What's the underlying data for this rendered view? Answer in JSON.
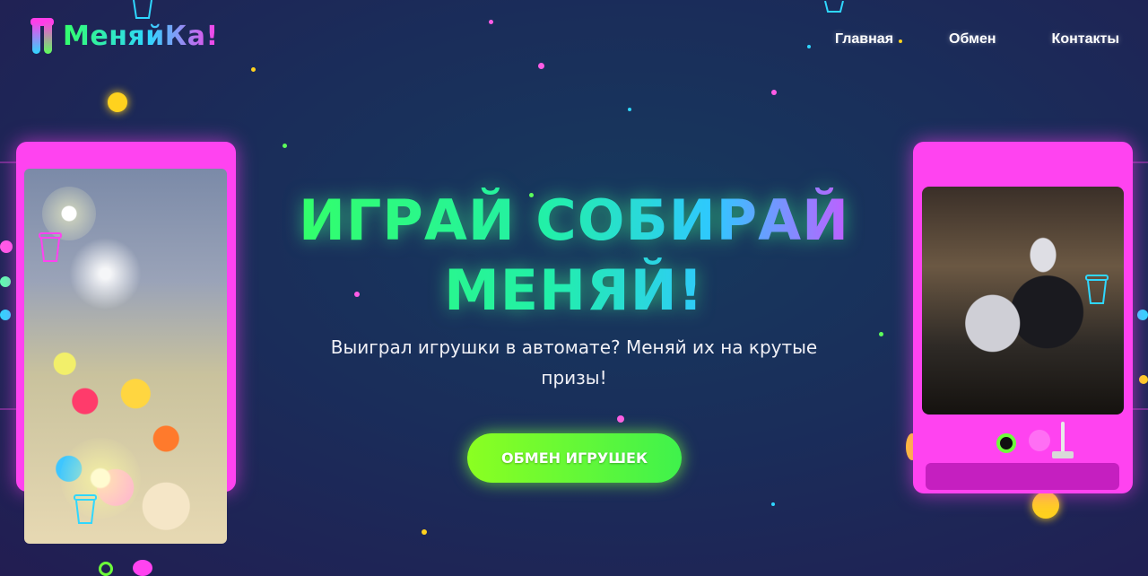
{
  "header": {
    "logo_text": "МеняйКа!",
    "nav": [
      {
        "label": "Главная"
      },
      {
        "label": "Обмен"
      },
      {
        "label": "Контакты"
      }
    ]
  },
  "hero": {
    "title": "ИГРАЙ СОБИРАЙ МЕНЯЙ!",
    "subtitle": "Выиграл игрушки в автомате? Меняй их на крутые призы!",
    "cta_label": "ОБМЕН ИГРУШЕК"
  },
  "colors": {
    "accent_pink": "#ff43f0",
    "accent_green": "#6dff3a",
    "accent_cyan": "#2fd7ff"
  },
  "icons": [
    "claw-logo-icon",
    "cup-icon",
    "joystick-icon"
  ]
}
